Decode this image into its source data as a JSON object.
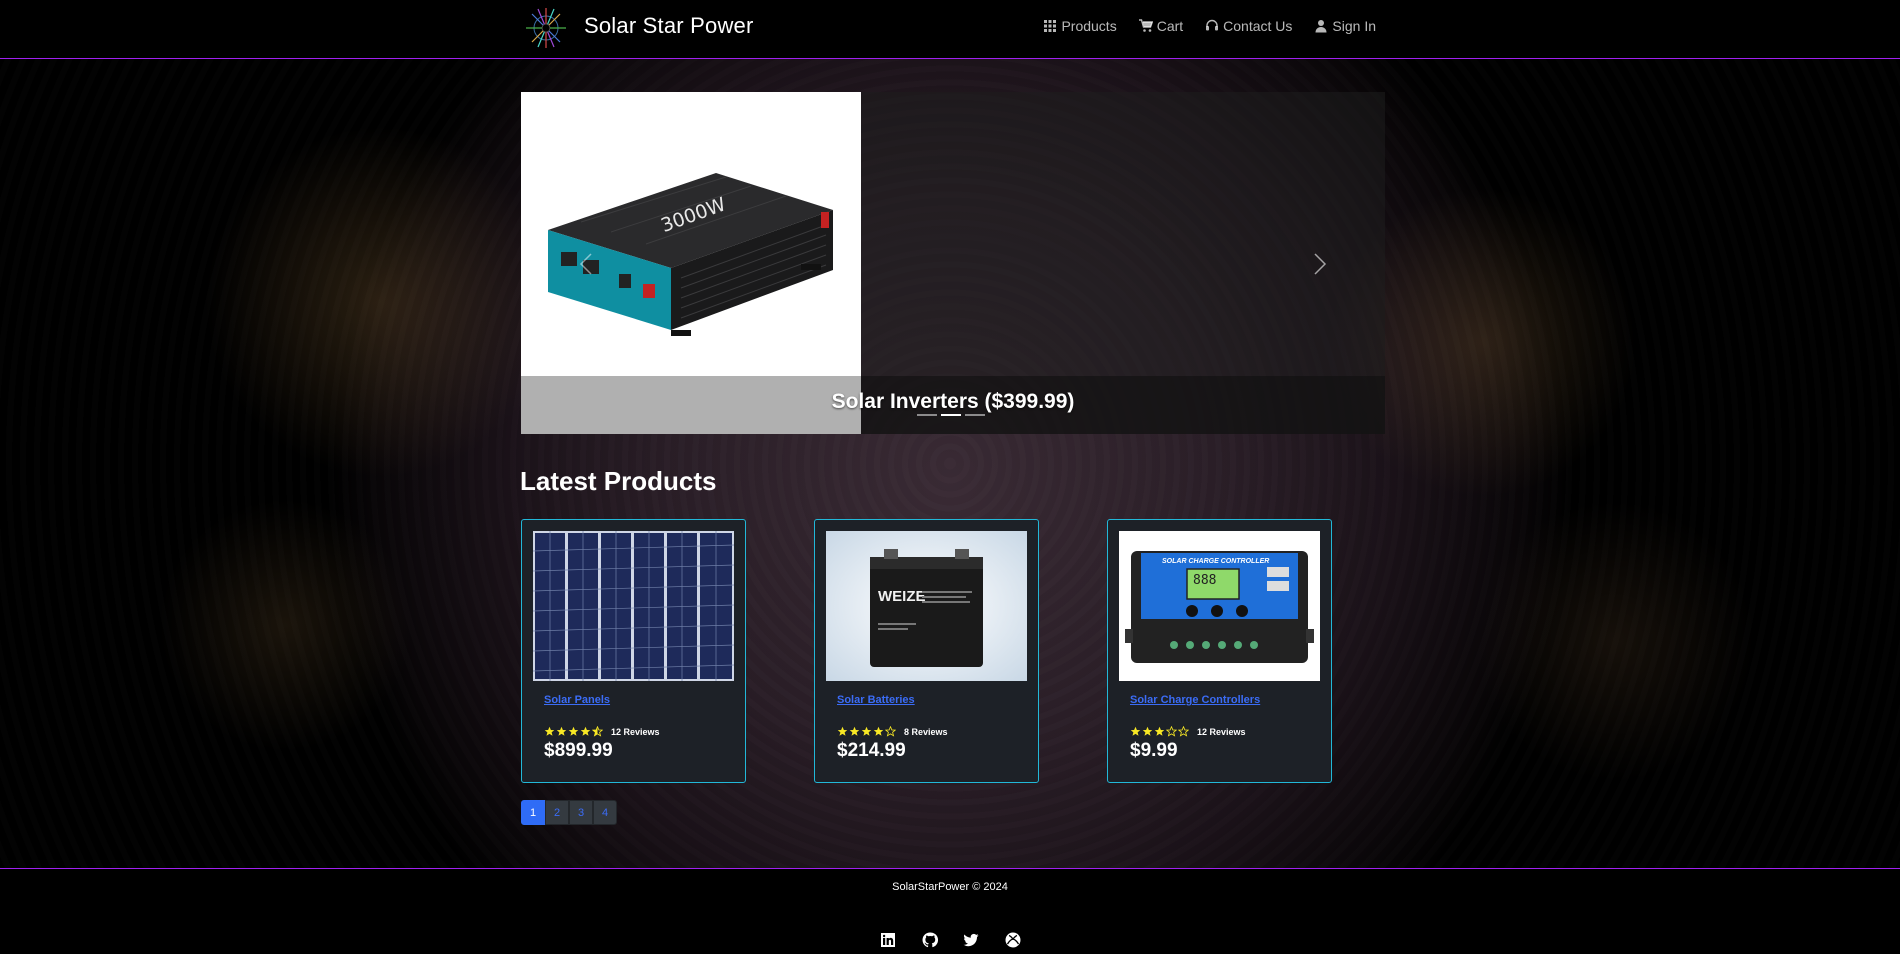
{
  "navbar": {
    "brand": "Solar Star Power",
    "links": [
      {
        "label": "Products",
        "icon": "grid-icon"
      },
      {
        "label": "Cart",
        "icon": "cart-icon"
      },
      {
        "label": "Contact Us",
        "icon": "headset-icon"
      },
      {
        "label": "Sign In",
        "icon": "user-icon"
      }
    ]
  },
  "carousel": {
    "caption": "Solar Inverters ($399.99)",
    "product_label": "3000W",
    "slide_count": 3,
    "active_slide": 2
  },
  "latest": {
    "title": "Latest Products",
    "products": [
      {
        "name": "Solar Panels",
        "rating": 4.5,
        "reviews": "12 Reviews",
        "price": "$899.99"
      },
      {
        "name": "Solar Batteries",
        "rating": 4,
        "reviews": "8 Reviews",
        "price": "$214.99"
      },
      {
        "name": "Solar Charge Controllers",
        "rating": 3,
        "reviews": "12 Reviews",
        "price": "$9.99"
      }
    ],
    "battery_brand": "WEIZE",
    "controller_title": "SOLAR CHARGE CONTROLLER",
    "controller_display": "888"
  },
  "pagination": {
    "pages": [
      "1",
      "2",
      "3",
      "4"
    ],
    "active": "1"
  },
  "footer": {
    "text": "SolarStarPower © 2024",
    "social": [
      "linkedin-icon",
      "github-icon",
      "twitter-icon",
      "xbox-icon"
    ]
  },
  "colors": {
    "accent": "#a020f0",
    "card_border": "#22b8d8",
    "link": "#3b6cf6",
    "star": "#f8e825"
  }
}
